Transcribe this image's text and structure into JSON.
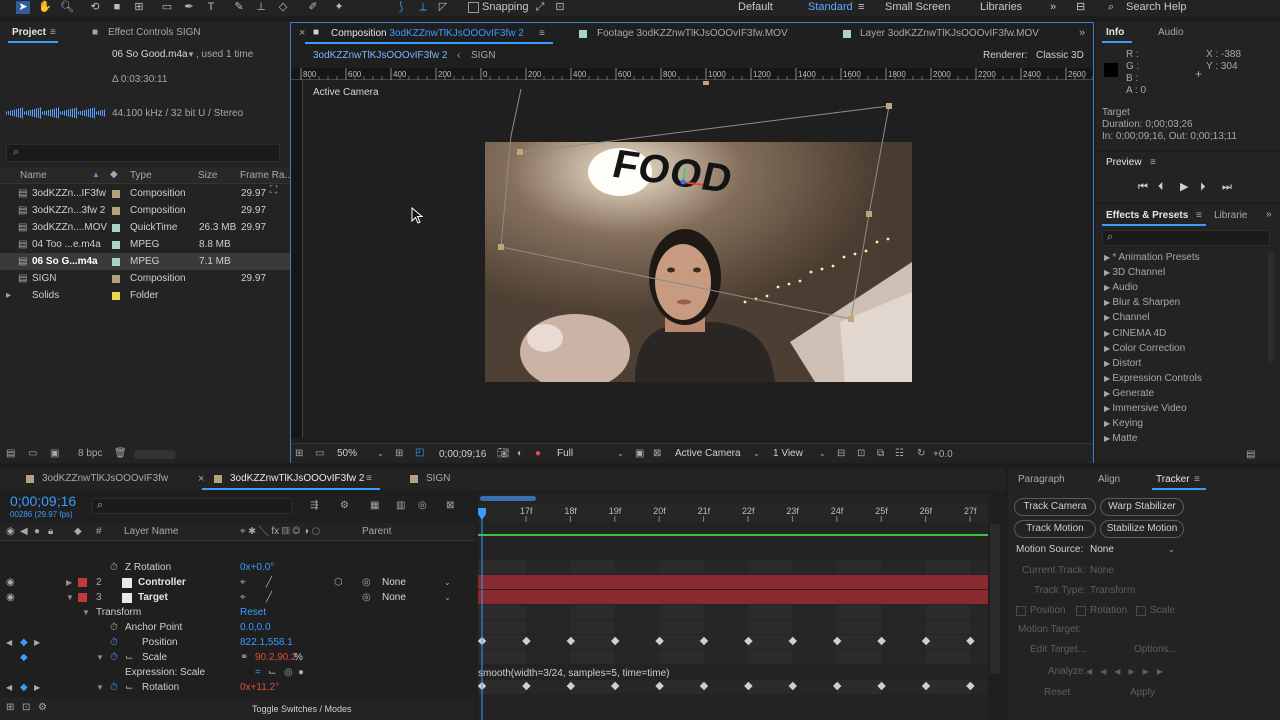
{
  "toolbar": {
    "snapping": "Snapping",
    "workspaces": [
      "Default",
      "Standard",
      "Small Screen",
      "Libraries"
    ],
    "active_workspace": "Standard",
    "search_help": "Search Help"
  },
  "project_panel": {
    "tab_project": "Project",
    "tab_effect_controls": "Effect Controls SIGN",
    "selected_name": "06 So Good.m4a",
    "used": ", used 1 time",
    "duration": "Δ 0:03:30:11",
    "audio_info": "44.100 kHz / 32 bit U / Stereo",
    "columns": [
      "Name",
      "Type",
      "Size",
      "Frame Ra..."
    ],
    "items": [
      {
        "name": "3odKZZn...IF3fw",
        "type": "Composition",
        "size": "",
        "fps": "29.97",
        "color": "#b3a17c"
      },
      {
        "name": "3odKZZn...3fw 2",
        "type": "Composition",
        "size": "",
        "fps": "29.97",
        "color": "#b3a17c"
      },
      {
        "name": "3odKZZn....MOV",
        "type": "QuickTime",
        "size": "26.3 MB",
        "fps": "29.97",
        "color": "#a7d4c9"
      },
      {
        "name": "04 Too ...e.m4a",
        "type": "MPEG",
        "size": "8.8 MB",
        "fps": "",
        "color": "#a7d4c9"
      },
      {
        "name": "06 So G...m4a",
        "type": "MPEG",
        "size": "7.1 MB",
        "fps": "",
        "color": "#a7d4c9"
      },
      {
        "name": "SIGN",
        "type": "Composition",
        "size": "",
        "fps": "29.97",
        "color": "#b3a17c"
      },
      {
        "name": "Solids",
        "type": "Folder",
        "size": "",
        "fps": "",
        "color": "#e8d94a"
      }
    ],
    "bpc": "8 bpc"
  },
  "viewer": {
    "tabs": [
      {
        "prefix": "Composition ",
        "name": "3odKZZnwTlKJsOOOvIF3fw 2"
      },
      {
        "prefix": "Footage ",
        "name": "3odKZZnwTlKJsOOOvIF3fw.MOV"
      },
      {
        "prefix": "Layer ",
        "name": "3odKZZnwTlKJsOOOvIF3fw.MOV"
      }
    ],
    "breadcrumb": [
      "3odKZZnwTlKJsOOOvIF3fw 2",
      "SIGN"
    ],
    "renderer_label": "Renderer:",
    "renderer": "Classic 3D",
    "ruler_ticks": [
      "800",
      "600",
      "400",
      "200",
      "0",
      "200",
      "400",
      "600",
      "800",
      "1000",
      "1200",
      "1400",
      "1600",
      "1800",
      "2000",
      "2200",
      "2400",
      "2600"
    ],
    "active_camera": "Active Camera",
    "overlay_text": "FOOD",
    "bottom": {
      "zoom": "50%",
      "time": "0;00;09;16",
      "resolution": "Full",
      "camera": "Active Camera",
      "views": "1 View",
      "exposure": "+0.0"
    }
  },
  "info": {
    "tab_info": "Info",
    "tab_audio": "Audio",
    "r": "R :",
    "g": "G :",
    "b": "B :",
    "a": "A : 0",
    "x": "X : -388",
    "y": "Y : 304",
    "target_label": "Target",
    "duration": "Duration: 0;00;03;26",
    "in_out": "In: 0;00;09;16, Out: 0;00;13;11"
  },
  "preview": {
    "title": "Preview"
  },
  "effects": {
    "tab": "Effects & Presets",
    "tab2": "Librarie",
    "items": [
      "* Animation Presets",
      "3D Channel",
      "Audio",
      "Blur & Sharpen",
      "Channel",
      "CINEMA 4D",
      "Color Correction",
      "Distort",
      "Expression Controls",
      "Generate",
      "Immersive Video",
      "Keying",
      "Matte"
    ]
  },
  "timeline": {
    "tabs": [
      "3odKZZnwTlKJsOOOvIF3fw",
      "3odKZZnwTlKJsOOOvIF3fw 2",
      "SIGN"
    ],
    "timecode": "0;00;09;16",
    "frames": "00286 (29.97 fps)",
    "col_layer_name": "Layer Name",
    "col_parent": "Parent",
    "ruler": [
      "17f",
      "18f",
      "19f",
      "20f",
      "21f",
      "22f",
      "23f",
      "24f",
      "25f",
      "26f",
      "27f"
    ],
    "rows": {
      "zrot_label": "Z Rotation",
      "zrot_value": "0x+0.0°",
      "layer2_num": "2",
      "layer2_name": "Controller",
      "layer2_parent": "None",
      "layer3_num": "3",
      "layer3_name": "Target",
      "layer3_parent": "None",
      "transform": "Transform",
      "reset": "Reset",
      "anchor_label": "Anchor Point",
      "anchor_value": "0.0,0.0",
      "position_label": "Position",
      "position_value": "822.1,558.1",
      "scale_label": "Scale",
      "scale_value": "90.2,90.2",
      "scale_unit": "%",
      "expr_label": "Expression: Scale",
      "expression": "smooth(width=3/24, samples=5, time=time)",
      "rotation_label": "Rotation",
      "rotation_value": "0x+11.2°"
    },
    "toggle": "Toggle Switches / Modes"
  },
  "tracker": {
    "tabs": [
      "Paragraph",
      "Align",
      "Tracker"
    ],
    "buttons": [
      "Track Camera",
      "Warp Stabilizer",
      "Track Motion",
      "Stabilize Motion"
    ],
    "motion_source_label": "Motion Source:",
    "motion_source": "None",
    "current_track_label": "Current Track:",
    "current_track": "None",
    "track_type_label": "Track Type:",
    "track_type": "Transform",
    "checks": [
      "Position",
      "Rotation",
      "Scale"
    ],
    "motion_target": "Motion Target:",
    "edit_target": "Edit Target...",
    "options": "Options...",
    "analyze": "Analyze:",
    "reset": "Reset",
    "apply": "Apply"
  }
}
